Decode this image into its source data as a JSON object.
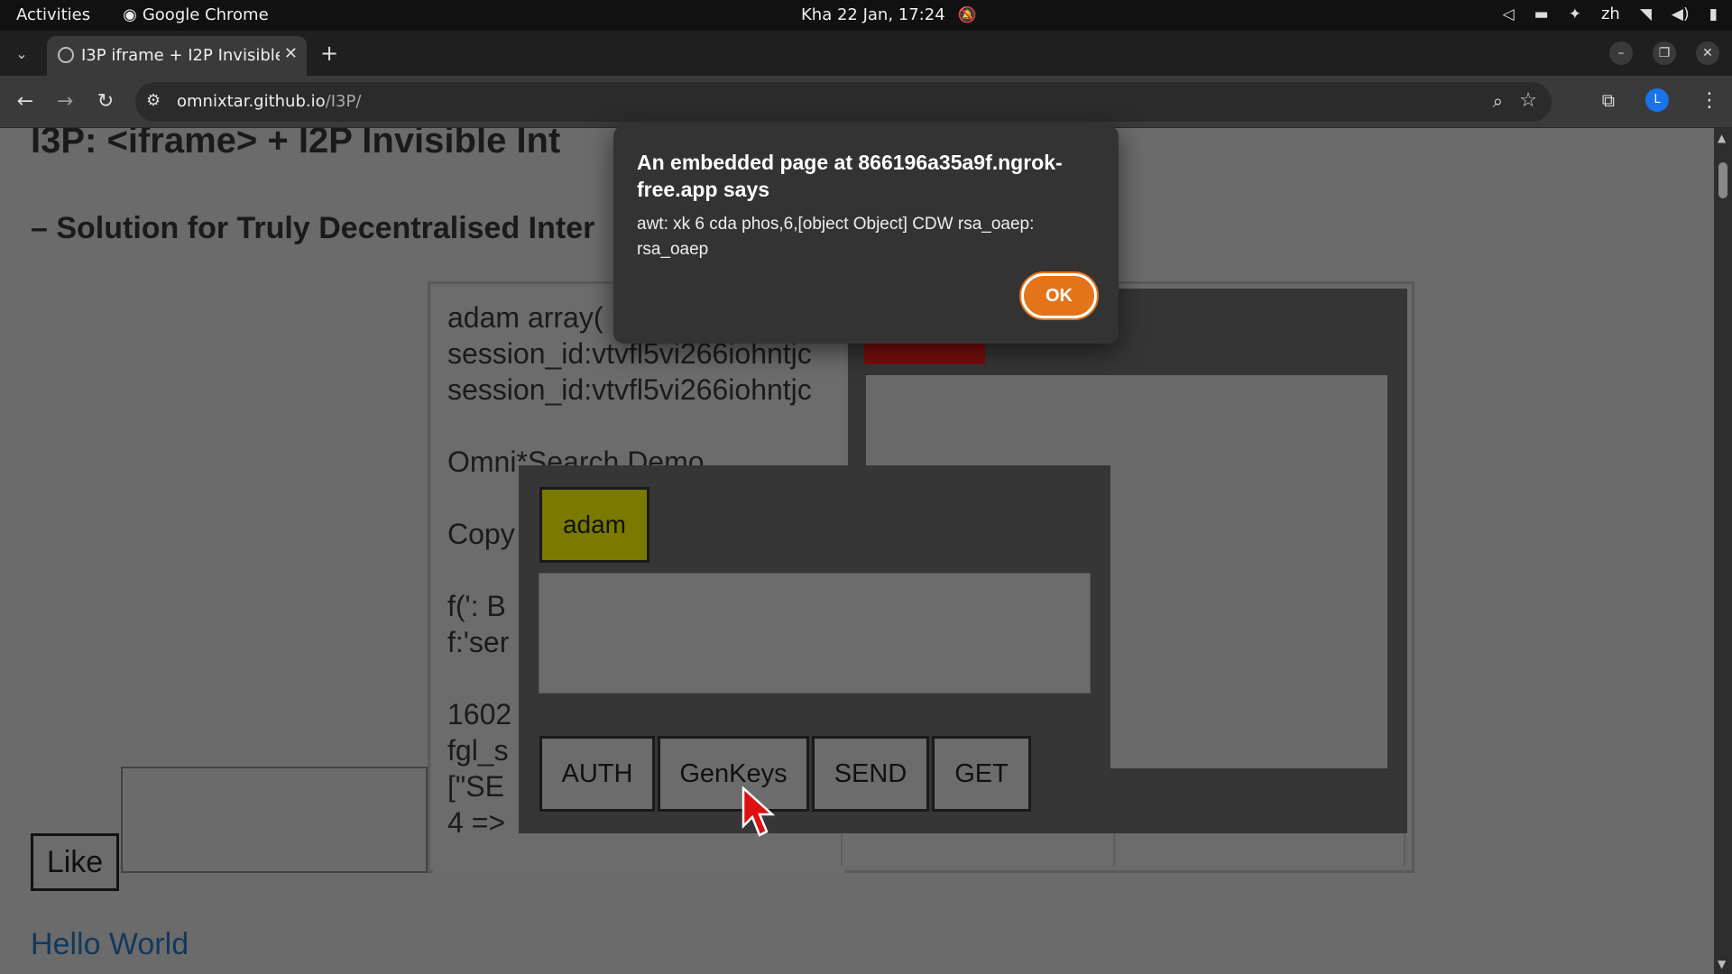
{
  "system_bar": {
    "activities": "Activities",
    "app_name": "Google Chrome",
    "datetime": "Kha 22 Jan, 17:24",
    "input_method": "zh"
  },
  "browser": {
    "tab_title": "I3P iframe + I2P Invisible",
    "url_host": "omnixtar.github.io",
    "url_path": "/I3P/",
    "profile_initial": "L"
  },
  "page": {
    "heading": "I3P: <iframe> + I2P Invisible Int",
    "subheading": "– Solution for Truly Decentralised Inter",
    "left_pane_text": "adam array(\nsession_id:vtvfl5vi266iohntjc\nsession_id:vtvfl5vi266iohntjc\n\nOmni*Search Demo\n\nCopy\n\nf(': B\nf:'ser\n\n1602\nfgl_s\n[\"SE\n4 =>",
    "widget": {
      "user_button": "adam",
      "buttons": [
        "AUTH",
        "GenKeys",
        "SEND",
        "GET"
      ]
    },
    "like_button": "Like",
    "hello_link": "Hello World"
  },
  "dialog": {
    "title": "An embedded page at 866196a35a9f.ngrok-free.app says",
    "message": " awt:   xk 6  cda phos,6,[object Object]  CDW rsa_oaep: rsa_oaep",
    "ok_label": "OK",
    "accent_color": "#e3741a"
  }
}
